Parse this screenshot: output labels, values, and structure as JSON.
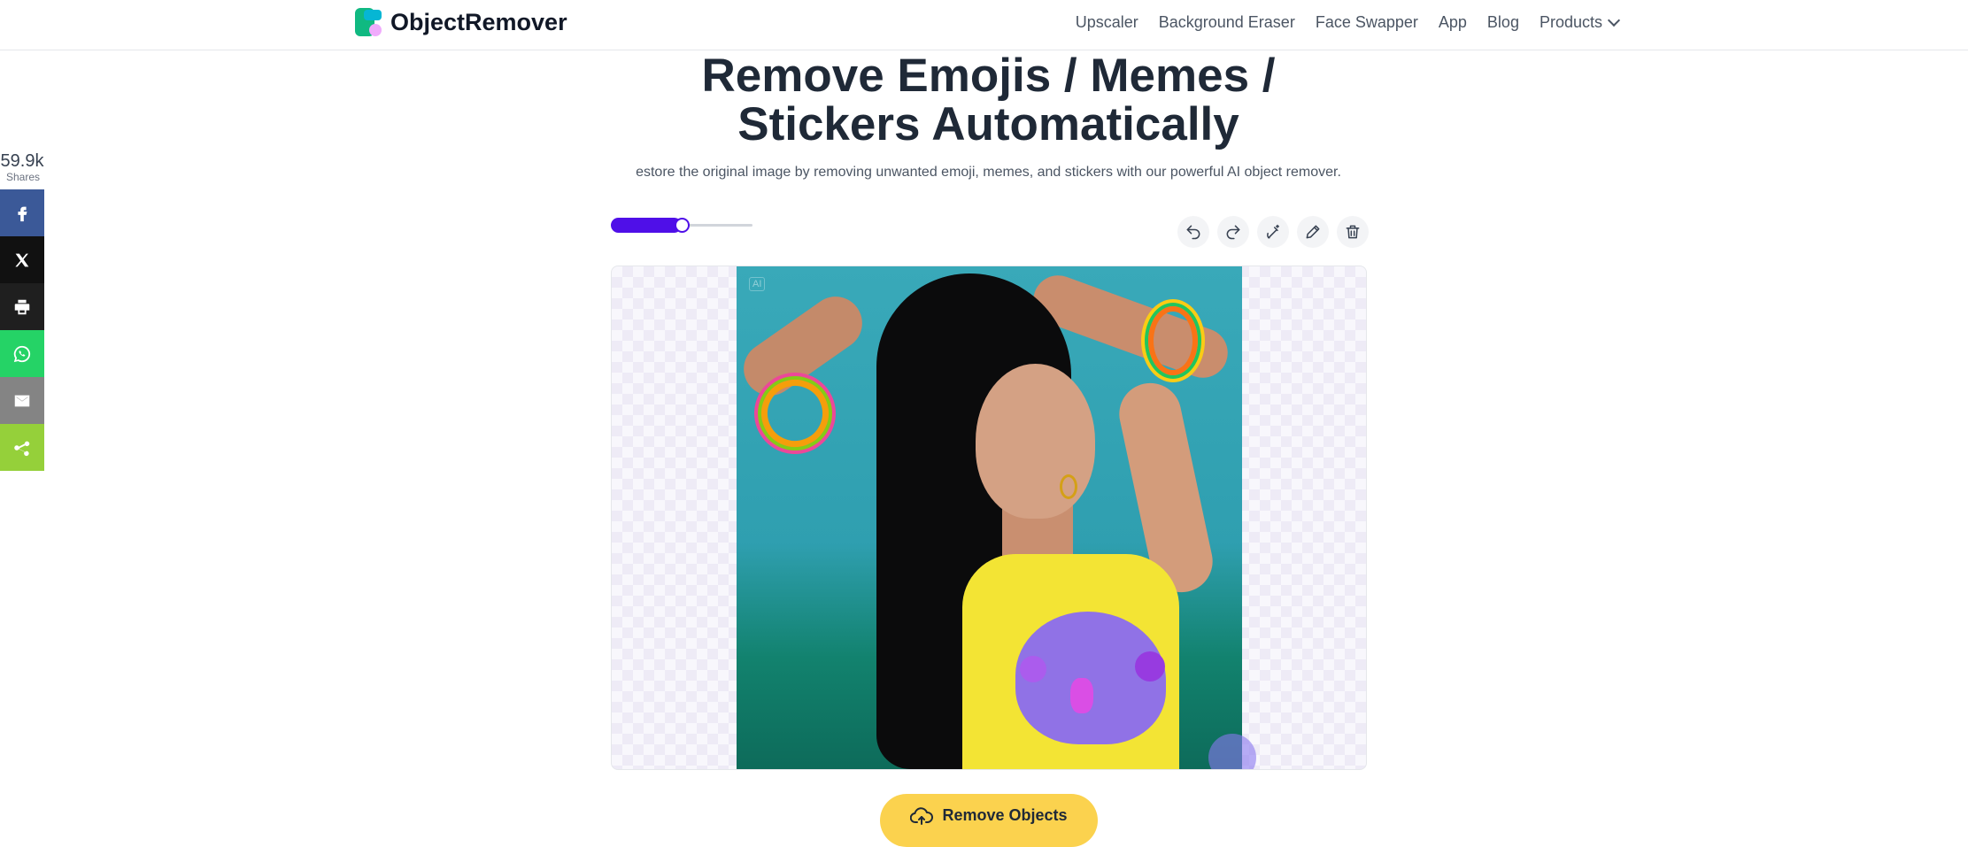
{
  "brand": {
    "name": "ObjectRemover"
  },
  "nav": {
    "items": [
      "Upscaler",
      "Background Eraser",
      "Face Swapper",
      "App",
      "Blog"
    ],
    "products_label": "Products"
  },
  "share": {
    "count": "59.9k",
    "label": "Shares"
  },
  "hero": {
    "title_line1": "Remove Emojis / Memes /",
    "title_line2": "Stickers Automatically",
    "subtitle": "estore the original image by removing unwanted emoji, memes, and stickers with our powerful AI object remover."
  },
  "brush": {
    "size_fraction": 0.5
  },
  "editor": {
    "ai_tag": "AI"
  },
  "actions": {
    "remove_label": "Remove Objects"
  }
}
